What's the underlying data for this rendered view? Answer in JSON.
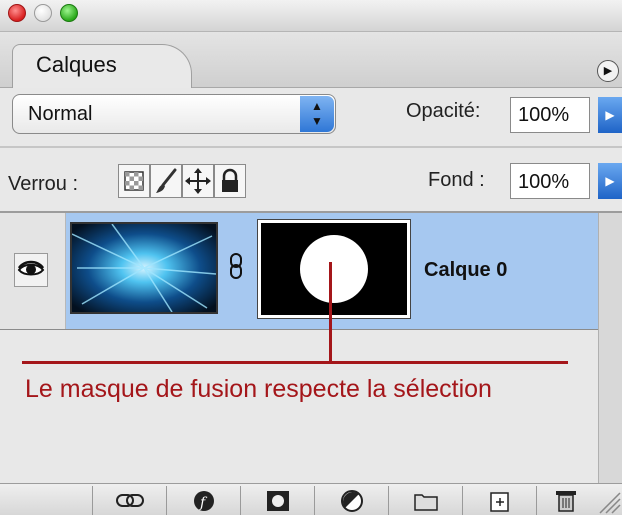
{
  "panel": {
    "tab_label": "Calques",
    "blend_mode": "Normal",
    "opacity_label": "Opacité:",
    "opacity_value": "100%",
    "lock_label": "Verrou :",
    "fill_label": "Fond :",
    "fill_value": "100%"
  },
  "layer": {
    "name": "Calque 0",
    "selected": true
  },
  "annotation": {
    "text": "Le masque de fusion respecte la sélection",
    "color": "#a4161a"
  },
  "colors": {
    "selection": "#a6c8f0",
    "accent": "#2f77d6"
  },
  "icons": {
    "lock": [
      "transparency-lock-icon",
      "paint-brush-icon",
      "move-icon",
      "padlock-icon"
    ],
    "toolbar": [
      "link-layers-icon",
      "layer-style-icon",
      "layer-mask-icon",
      "adjustment-layer-icon",
      "folder-icon",
      "new-layer-icon",
      "trash-icon"
    ]
  }
}
